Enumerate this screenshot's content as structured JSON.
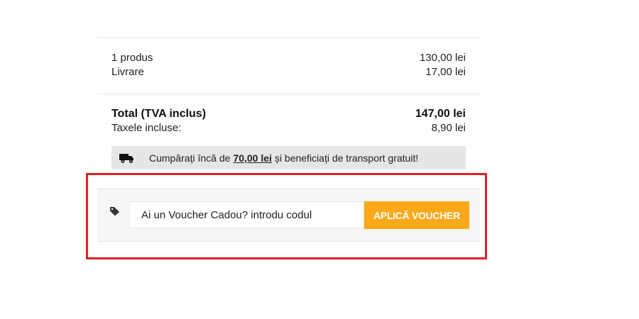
{
  "summary": {
    "products_label": "1 produs",
    "products_value": "130,00 lei",
    "shipping_label": "Livrare",
    "shipping_value": "17,00 lei"
  },
  "totals": {
    "total_label": "Total (TVA inclus)",
    "total_value": "147,00 lei",
    "taxes_label": "Taxele incluse:",
    "taxes_value": "8,90 lei"
  },
  "free_shipping": {
    "icon": "truck-icon",
    "text_before": "Cumpărați încă de",
    "amount": "70,00 lei",
    "text_after": "și beneficiați de transport gratuit!"
  },
  "voucher": {
    "icon": "tag-icon",
    "placeholder": "Ai un Voucher Cadou? introdu codul",
    "button_label": "APLICĂ VOUCHER"
  },
  "colors": {
    "accent": "#fba819",
    "highlight": "#e02028",
    "bar_background": "#e6e6e6"
  }
}
